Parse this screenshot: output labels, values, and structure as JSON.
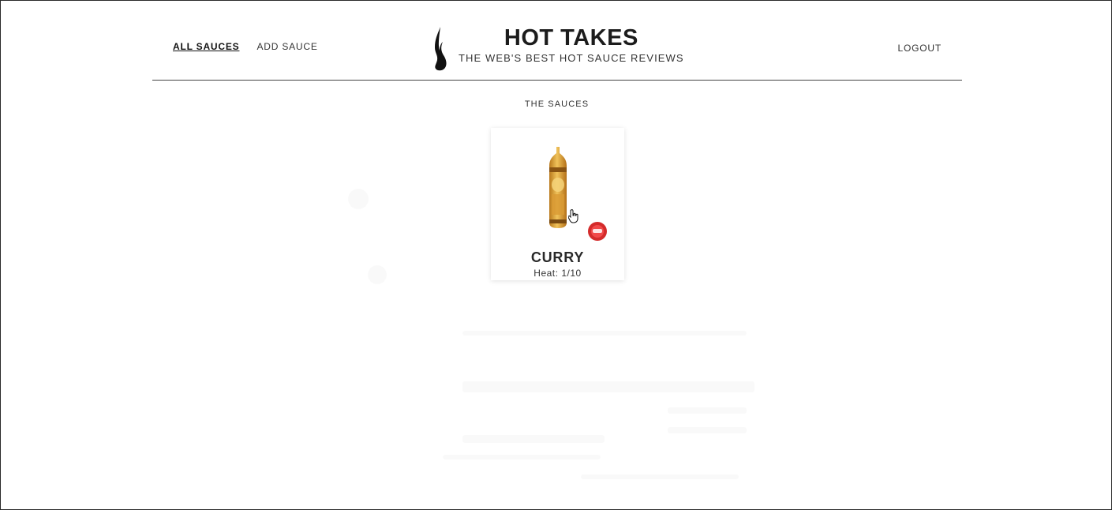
{
  "nav": {
    "all_sauces": "ALL SAUCES",
    "add_sauce": "ADD SAUCE",
    "logout": "LOGOUT"
  },
  "brand": {
    "title": "HOT TAKES",
    "tagline": "THE WEB'S BEST HOT SAUCE REVIEWS"
  },
  "section": {
    "title": "THE SAUCES"
  },
  "sauces": [
    {
      "name": "CURRY",
      "heat_label": "Heat:",
      "heat_value": "1/10"
    }
  ],
  "colors": {
    "bottle": "#e0a838",
    "badge": "#d42b2b",
    "rule": "#444444"
  },
  "icons": {
    "logo": "flame-icon",
    "cursor": "hand-pointer-icon"
  }
}
